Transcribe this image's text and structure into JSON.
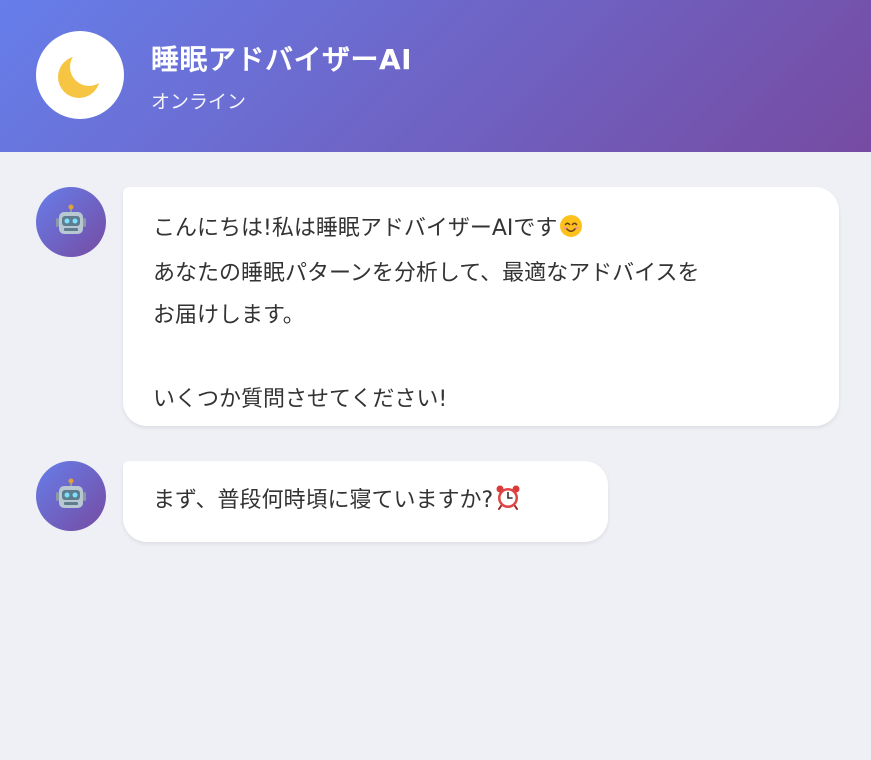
{
  "header": {
    "title": "睡眠アドバイザーAI",
    "status": "オンライン",
    "avatar_icon": "crescent-moon-icon"
  },
  "messages": [
    {
      "sender_icon": "robot-icon",
      "lines": [
        "こんにちは!私は睡眠アドバイザーAIです",
        "あなたの睡眠パターンを分析して、最適なアドバイスを",
        "お届けします。",
        "",
        "いくつか質問させてください!"
      ],
      "emoji": "smiling-face-icon"
    },
    {
      "sender_icon": "robot-icon",
      "lines": [
        "まず、普段何時頃に寝ていますか?"
      ],
      "emoji": "alarm-clock-icon"
    }
  ],
  "colors": {
    "header_gradient_start": "#667eea",
    "header_gradient_end": "#764ba2",
    "background": "#eff0f5",
    "bubble": "#ffffff",
    "text": "#333333"
  }
}
